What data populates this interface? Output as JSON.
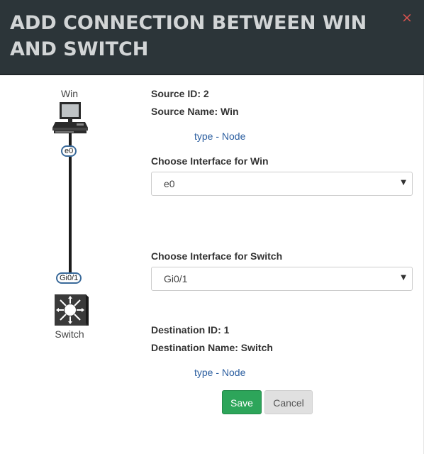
{
  "dialog": {
    "title": "ADD CONNECTION BETWEEN WIN AND SWITCH",
    "close_label": "×"
  },
  "topology": {
    "source_node_label": "Win",
    "source_interface": "e0",
    "dest_node_label": "Switch",
    "dest_interface": "Gi0/1",
    "icons": {
      "source": "computer-icon",
      "dest": "switch-icon"
    }
  },
  "source": {
    "id_text": "Source ID: 2",
    "name_text": "Source Name: Win",
    "type_text": "type - Node"
  },
  "source_interface": {
    "label": "Choose Interface for Win",
    "selected": "e0"
  },
  "dest_interface": {
    "label": "Choose Interface for Switch",
    "selected": "Gi0/1"
  },
  "destination": {
    "id_text": "Destination ID: 1",
    "name_text": "Destination Name: Switch",
    "type_text": "type - Node"
  },
  "actions": {
    "save_label": "Save",
    "cancel_label": "Cancel"
  },
  "colors": {
    "header_bg": "#2c3539",
    "title_text": "#d2d5d6",
    "close": "#d9534f",
    "save_bg": "#2da55a",
    "cancel_bg": "#e0e0e0",
    "link": "#2a5d9f"
  }
}
